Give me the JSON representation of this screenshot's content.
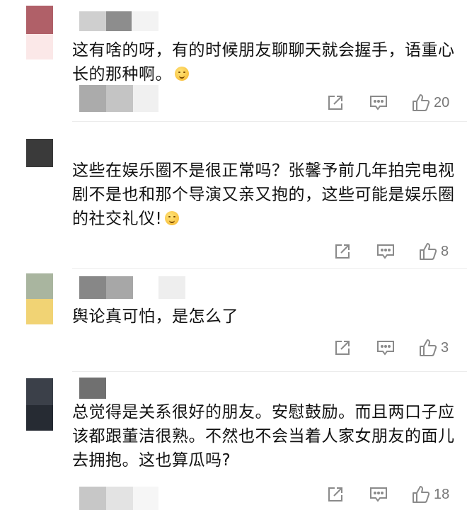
{
  "comments": [
    {
      "text": "这有啥的呀，有的时候朋友聊聊天就会握手，语重心长的那种啊。",
      "emoji": "sweat-smile-emoji",
      "likes": "20"
    },
    {
      "text": "这些在娱乐圈不是很正常吗？张馨予前几年拍完电视剧不是也和那个导演又亲又抱的，这些可能是娱乐圈的社交礼仪!",
      "emoji": "smile-emoji",
      "likes": "8"
    },
    {
      "text": "舆论真可怕，是怎么了",
      "likes": "3"
    },
    {
      "text": "总觉得是关系很好的朋友。安慰鼓励。而且两口子应该都跟董洁很熟。不然也不会当着人家女朋友的面儿去拥抱。这也算瓜吗?",
      "likes": "18"
    }
  ],
  "icons": {
    "share": "share-icon",
    "reply": "comment-icon",
    "like": "thumbs-up-icon"
  },
  "colors": {
    "icon": "#8a8a8a",
    "text": "#111111",
    "divider": "#ececec"
  }
}
